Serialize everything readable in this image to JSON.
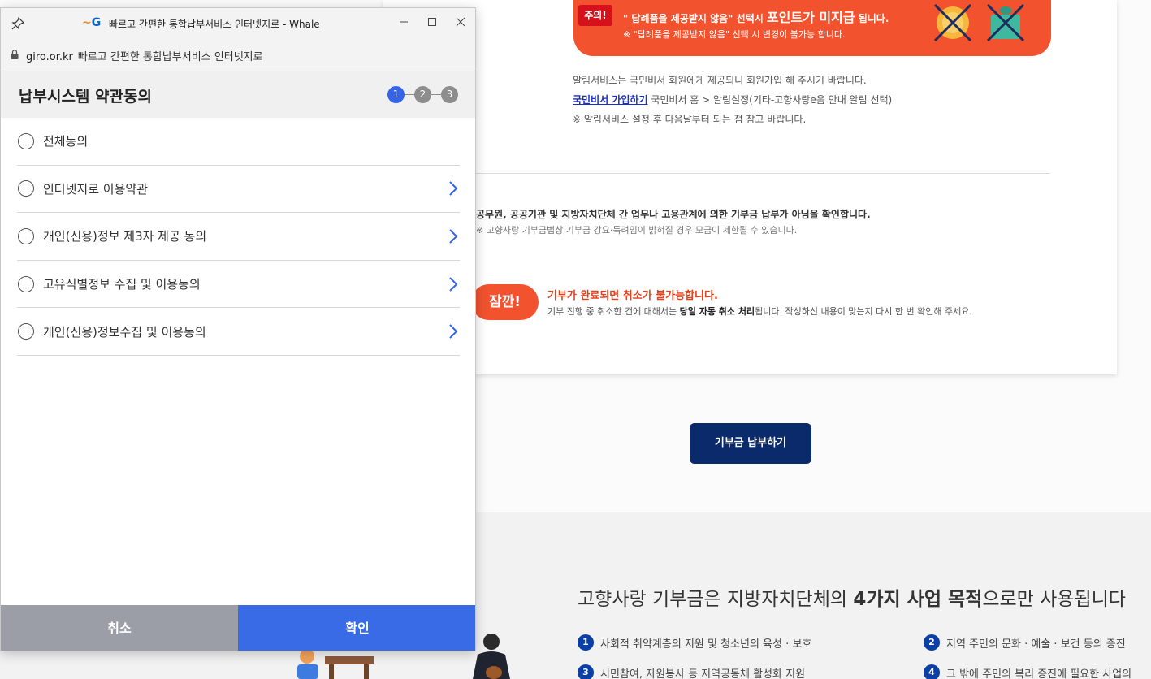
{
  "background": {
    "warning": {
      "tag": "주의!",
      "line1_prefix": "\" 답례품을 제공받지 않음\" 선택시 ",
      "line1_emphasis": "포인트가 미지급",
      "line1_suffix": " 됩니다.",
      "line2": "※ \"답례품을 제공받지 않음\" 선택 시 변경이 불가능 합니다."
    },
    "alarm": {
      "line1": "알림서비스는 국민비서 회원에게 제공되니 회원가입 해 주시기 바랍니다.",
      "link": "국민비서 가입하기",
      "line2_rest": " 국민비서 홈 > 알림설정(기타-고향사랑e음 안내 알림 선택)",
      "line3": "※ 알림서비스 설정 후 다음날부터 되는 점 참고 바랍니다."
    },
    "confirm": {
      "line1": "공무원, 공공기관 및 지방자치단체 간 업무나 고용관계에 의한 기부금 납부가 아님을 확인합니다.",
      "line2": "※ 고향사랑 기부금법상 기부금 강요·독려임이 밝혀질 경우 모금이 제한될 수 있습니다."
    },
    "wait": {
      "badge": "잠깐!",
      "title": "기부가 완료되면 취소가 불가능합니다.",
      "desc_prefix": "기부 진행 중 취소한 건에 대해서는 ",
      "desc_bold": "당일 자동 취소 처리",
      "desc_suffix": "됩니다. 작성하신 내용이 맞는지 다시 한 번 확인해 주세요."
    },
    "pay_button": "기부금 납부하기",
    "purpose": {
      "title_prefix": "고향사랑 기부금은 지방자치단체의 ",
      "title_bold": "4가지 사업 목적",
      "title_suffix": "으로만 사용됩니다",
      "items": [
        {
          "num": "1",
          "text": "사회적 취약계층의 지원 및 청소년의 육성 · 보호"
        },
        {
          "num": "2",
          "text": "지역 주민의 문화 · 예술 · 보건 등의 증진"
        },
        {
          "num": "3",
          "text": "시민참여, 자원봉사 등 지역공동체 활성화 지원"
        },
        {
          "num": "4",
          "text": "그 밖에 주민의 복리 증진에 필요한 사업의"
        }
      ]
    }
  },
  "popup": {
    "window_title": "빠르고 간편한 통합납부서비스 인터넷지로 - Whale",
    "logo_text": "G",
    "url_host": "giro.or.kr",
    "url_page_title": "빠르고 간편한 통합납부서비스 인터넷지로",
    "header_title": "납부시스템 약관동의",
    "steps": [
      "1",
      "2",
      "3"
    ],
    "terms": [
      {
        "label": "전체동의",
        "has_chevron": false
      },
      {
        "label": "인터넷지로 이용약관",
        "has_chevron": true
      },
      {
        "label": "개인(신용)정보 제3자 제공 동의",
        "has_chevron": true
      },
      {
        "label": "고유식별정보 수집 및 이용동의",
        "has_chevron": true
      },
      {
        "label": "개인(신용)정보수집 및 이용동의",
        "has_chevron": true
      }
    ],
    "cancel_label": "취소",
    "ok_label": "확인"
  },
  "colors": {
    "step_active": "#3563e9",
    "step_inactive": "#8d8d8d",
    "ok_button": "#3a6be6",
    "cancel_button": "#9b9ea6",
    "warning_banner": "#f2522e",
    "pay_button": "#0b2a6b"
  }
}
